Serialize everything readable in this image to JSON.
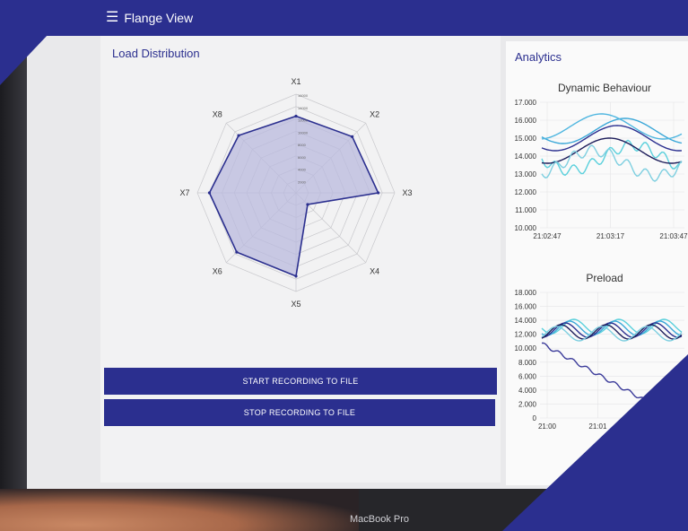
{
  "app": {
    "title": "Flange View",
    "menu_icon": "hamburger-menu-icon"
  },
  "load_distribution": {
    "title": "Load Distribution",
    "axes": [
      "X1",
      "X2",
      "X3",
      "X4",
      "X5",
      "X6",
      "X7",
      "X8"
    ],
    "rings": [
      "16000",
      "14000",
      "12000",
      "10000",
      "8000",
      "6000",
      "4000",
      "2000"
    ],
    "values": [
      14000,
      14500,
      15000,
      3000,
      15200,
      15300,
      15800,
      14800
    ],
    "max": 18000
  },
  "buttons": {
    "start": "START RECORDING TO FILE",
    "stop": "STOP RECORDING TO FILE"
  },
  "analytics": {
    "title": "Analytics"
  },
  "dynamic_behaviour": {
    "title": "Dynamic Behaviour",
    "y_ticks": [
      "17.000",
      "16.000",
      "15.000",
      "14.000",
      "13.000",
      "12.000",
      "11.000",
      "10.000"
    ],
    "x_ticks": [
      "21:02:47",
      "21:03:17",
      "21:03:47"
    ]
  },
  "preload": {
    "title": "Preload",
    "y_ticks": [
      "18.000",
      "16.000",
      "14.000",
      "12.000",
      "10.000",
      "8.000",
      "6.000",
      "4.000",
      "2.000",
      "0"
    ],
    "x_ticks": [
      "21:00",
      "21:01"
    ]
  },
  "device_label": "MacBook Pro",
  "colors": {
    "primary": "#2b2f8f",
    "radar_fill": "#b9b9de"
  }
}
